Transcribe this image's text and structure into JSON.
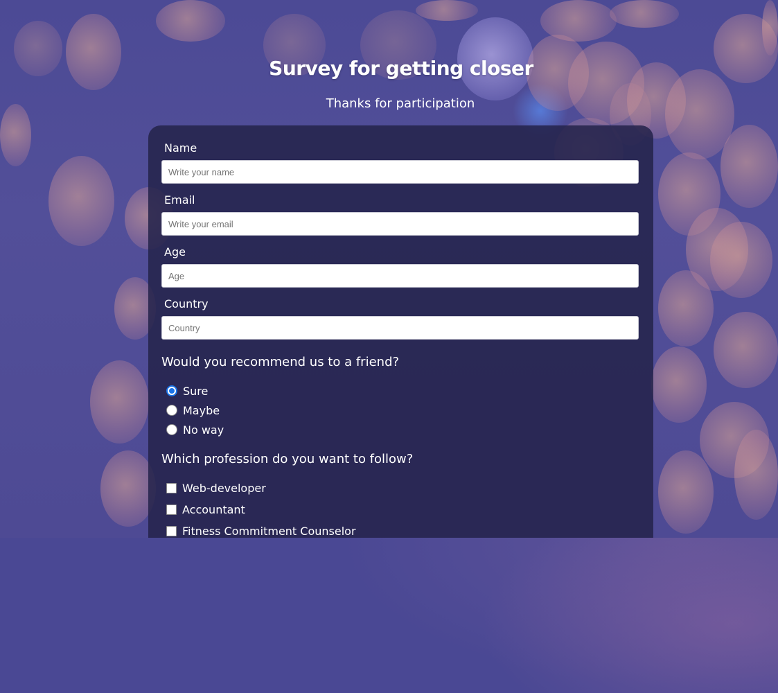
{
  "header": {
    "title": "Survey for getting closer",
    "subtitle": "Thanks for participation"
  },
  "form": {
    "fields": [
      {
        "label": "Name",
        "placeholder": "Write your name"
      },
      {
        "label": "Email",
        "placeholder": "Write your email"
      },
      {
        "label": "Age",
        "placeholder": "Age"
      },
      {
        "label": "Country",
        "placeholder": "Country"
      }
    ],
    "recommend": {
      "question": "Would you recommend us to a friend?",
      "options": [
        "Sure",
        "Maybe",
        "No way"
      ],
      "selected": "Sure"
    },
    "profession": {
      "question": "Which profession do you want to follow?",
      "options": [
        "Web-developer",
        "Accountant",
        "Fitness Commitment Counselor"
      ]
    }
  },
  "colors": {
    "background": "#4a4894",
    "card": "#24234a",
    "radio_accent": "#1a73e8"
  }
}
